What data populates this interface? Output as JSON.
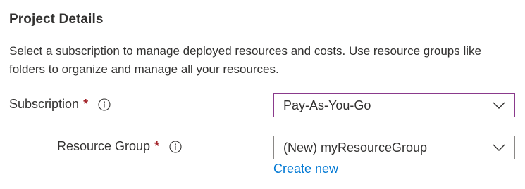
{
  "section": {
    "title": "Project Details",
    "description": "Select a subscription to manage deployed resources and costs. Use resource groups like folders to organize and manage all your resources."
  },
  "subscription": {
    "label": "Subscription",
    "required_marker": "*",
    "icon": "info-icon",
    "value": "Pay-As-You-Go"
  },
  "resource_group": {
    "label": "Resource Group",
    "required_marker": "*",
    "icon": "info-icon",
    "value": "(New) myResourceGroup",
    "create_new_label": "Create new"
  },
  "colors": {
    "text": "#323130",
    "required": "#a4262c",
    "link": "#0078d4",
    "focus_border": "#8a3a8c",
    "border": "#8a8886"
  }
}
